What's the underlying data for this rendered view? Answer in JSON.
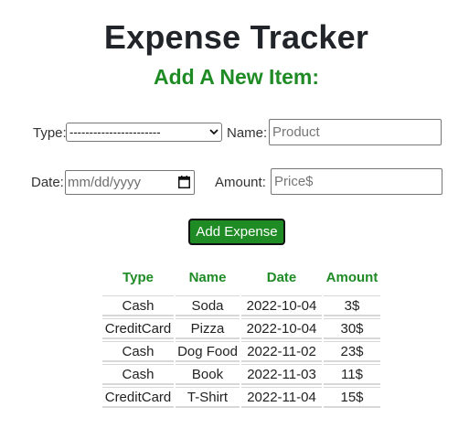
{
  "header": {
    "title": "Expense Tracker",
    "subtitle": "Add A New Item:"
  },
  "form": {
    "type_label": "Type:",
    "type_selected": "-----------------------",
    "name_label": "Name:",
    "name_placeholder": "Product",
    "date_label": "Date:",
    "date_placeholder": "mm/dd/yyyy",
    "amount_label": "Amount:",
    "amount_placeholder": "Price$",
    "submit_label": "Add Expense"
  },
  "table": {
    "headers": [
      "Type",
      "Name",
      "Date",
      "Amount"
    ],
    "rows": [
      [
        "Cash",
        "Soda",
        "2022-10-04",
        "3$"
      ],
      [
        "CreditCard",
        "Pizza",
        "2022-10-04",
        "30$"
      ],
      [
        "Cash",
        "Dog Food",
        "2022-11-02",
        "23$"
      ],
      [
        "Cash",
        "Book",
        "2022-11-03",
        "11$"
      ],
      [
        "CreditCard",
        "T-Shirt",
        "2022-11-04",
        "15$"
      ]
    ]
  },
  "colors": {
    "accent": "#1e8b25",
    "title": "#212529"
  },
  "icons": {
    "select_arrow": "chevron-down-icon",
    "date_picker": "calendar-icon"
  }
}
